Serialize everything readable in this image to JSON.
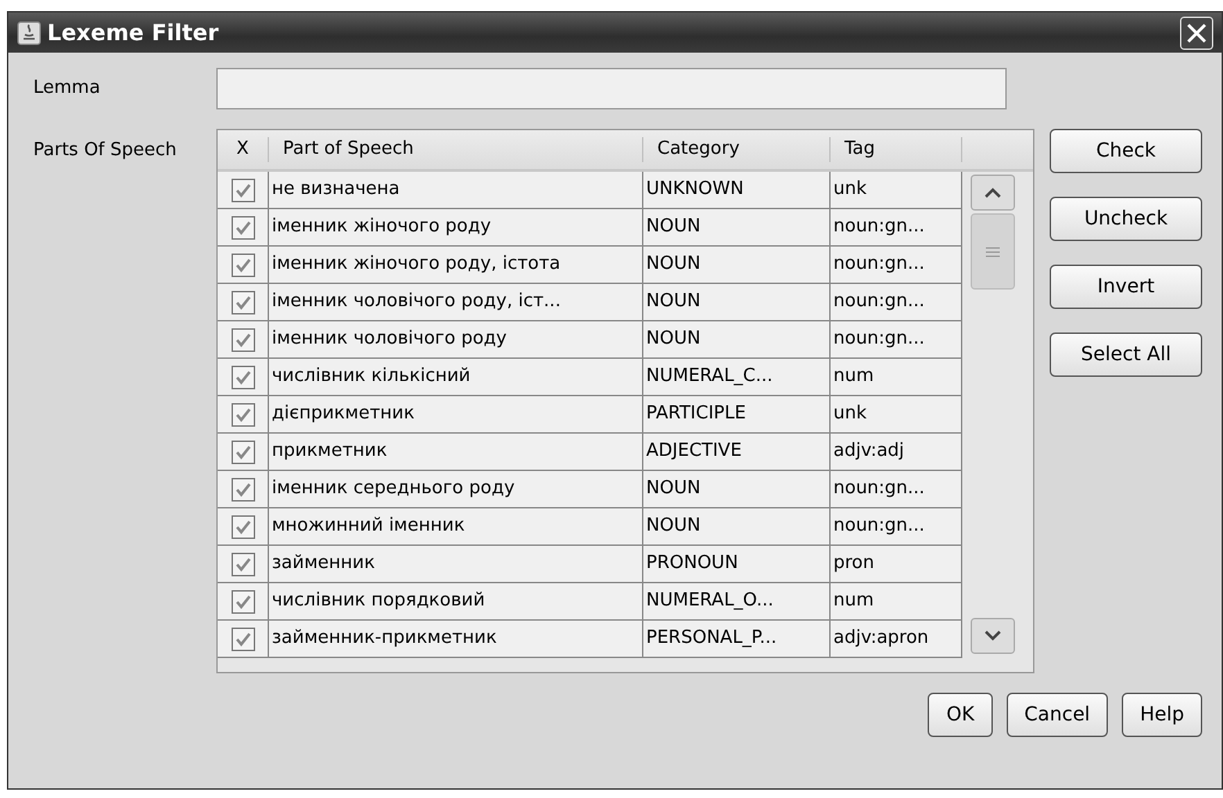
{
  "window": {
    "title": "Lexeme Filter"
  },
  "lemma": {
    "label": "Lemma"
  },
  "parts_of_speech": {
    "label": "Parts Of Speech",
    "columns": [
      "X",
      "Part of Speech",
      "Category",
      "Tag"
    ],
    "rows": [
      {
        "checked": true,
        "part": "не визначена",
        "category": "UNKNOWN",
        "tag": "unk"
      },
      {
        "checked": true,
        "part": "іменник жіночого роду",
        "category": "NOUN",
        "tag": "noun:gn..."
      },
      {
        "checked": true,
        "part": "іменник жіночого роду, істота",
        "category": "NOUN",
        "tag": "noun:gn..."
      },
      {
        "checked": true,
        "part": "іменник чоловічого роду, іст...",
        "category": "NOUN",
        "tag": "noun:gn..."
      },
      {
        "checked": true,
        "part": "іменник чоловічого роду",
        "category": "NOUN",
        "tag": "noun:gn..."
      },
      {
        "checked": true,
        "part": "числівник кількісний",
        "category": "NUMERAL_C...",
        "tag": "num"
      },
      {
        "checked": true,
        "part": "дієприкметник",
        "category": "PARTICIPLE",
        "tag": "unk"
      },
      {
        "checked": true,
        "part": "прикметник",
        "category": "ADJECTIVE",
        "tag": "adjv:adj"
      },
      {
        "checked": true,
        "part": "іменник середнього роду",
        "category": "NOUN",
        "tag": "noun:gn..."
      },
      {
        "checked": true,
        "part": "множинний іменник",
        "category": "NOUN",
        "tag": "noun:gn..."
      },
      {
        "checked": true,
        "part": "займенник",
        "category": "PRONOUN",
        "tag": "pron"
      },
      {
        "checked": true,
        "part": "числівник порядковий",
        "category": "NUMERAL_O...",
        "tag": "num"
      },
      {
        "checked": true,
        "part": "займенник-прикметник",
        "category": "PERSONAL_P...",
        "tag": "adjv:apron"
      }
    ]
  },
  "side_buttons": [
    "Check",
    "Uncheck",
    "Invert",
    "Select All"
  ],
  "buttons": [
    "OK",
    "Cancel",
    "Help"
  ]
}
